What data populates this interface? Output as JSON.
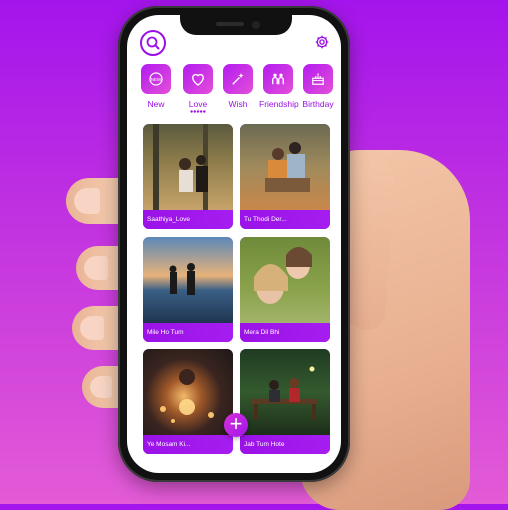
{
  "categories": [
    {
      "label": "New",
      "icon": "new-badge-icon"
    },
    {
      "label": "Love",
      "icon": "heart-icon"
    },
    {
      "label": "Wish",
      "icon": "wish-wand-icon"
    },
    {
      "label": "Friendship",
      "icon": "friendship-icon"
    },
    {
      "label": "Birthday",
      "icon": "birthday-cake-icon"
    }
  ],
  "selected_category": "Love",
  "cards": [
    {
      "title": "Saathiya_Love"
    },
    {
      "title": "Tu Thodi Der..."
    },
    {
      "title": "Mile Ho Tum"
    },
    {
      "title": "Mera Dil Bhi"
    },
    {
      "title": "Ye Mosam Ki..."
    },
    {
      "title": "Jab Tum Hote"
    }
  ],
  "icons": {
    "search": "search-icon",
    "settings": "gear-icon",
    "add": "plus-icon"
  },
  "colors": {
    "accent": "#9a10e6",
    "background_top": "#a414ec",
    "background_bottom": "#e35bd6"
  }
}
